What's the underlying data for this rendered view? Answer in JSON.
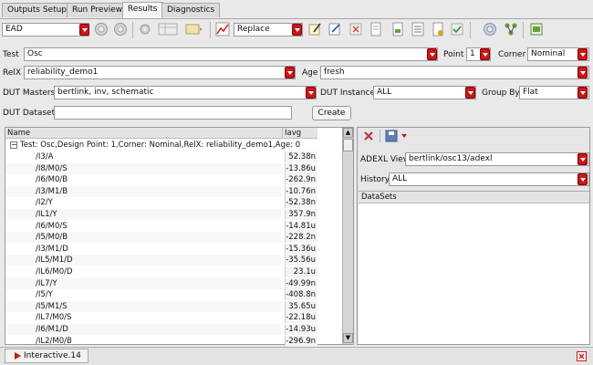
{
  "tabs": [
    {
      "label": "Outputs Setup",
      "active": false
    },
    {
      "label": "Run Preview",
      "active": false
    },
    {
      "label": "Results",
      "active": true
    },
    {
      "label": "Diagnostics",
      "active": false
    }
  ],
  "toolbar": {
    "view_combo": "EAD",
    "mode_combo": "Replace"
  },
  "filters": {
    "test_label": "Test",
    "test_value": "Osc",
    "point_label": "Point",
    "point_value": "1",
    "corner_label": "Corner",
    "corner_value": "Nominal",
    "relx_label": "RelX",
    "relx_value": "reliability_demo1",
    "age_label": "Age",
    "age_value": "fresh",
    "dut_masters_label": "DUT Masters",
    "dut_masters_value": "bertlink, inv, schematic",
    "dut_instance_label": "DUT Instance",
    "dut_instance_value": "ALL",
    "group_by_label": "Group By",
    "group_by_value": "Flat",
    "dut_dataset_label": "DUT Dataset",
    "dut_dataset_value": "",
    "create_label": "Create"
  },
  "table": {
    "col_name": "Name",
    "col_iavg": "Iavg",
    "group_row": "Test: Osc,Design Point: 1,Corner: Nominal,RelX: reliability_demo1,Age: 0",
    "rows": [
      {
        "name": "/I3/A",
        "iavg": "52.38n"
      },
      {
        "name": "/I8/M0/S",
        "iavg": "-13.86u"
      },
      {
        "name": "/I6/M0/B",
        "iavg": "-262.9n"
      },
      {
        "name": "/I3/M1/B",
        "iavg": "-10.76n"
      },
      {
        "name": "/I2/Y",
        "iavg": "-52.38n"
      },
      {
        "name": "/IL1/Y",
        "iavg": "357.9n"
      },
      {
        "name": "/I6/M0/S",
        "iavg": "-14.81u"
      },
      {
        "name": "/I5/M0/B",
        "iavg": "-228.2n"
      },
      {
        "name": "/I3/M1/D",
        "iavg": "-15.36u"
      },
      {
        "name": "/IL5/M1/D",
        "iavg": "-35.56u"
      },
      {
        "name": "/IL6/M0/D",
        "iavg": "23.1u"
      },
      {
        "name": "/IL7/Y",
        "iavg": "-49.99n"
      },
      {
        "name": "/I5/Y",
        "iavg": "-408.8n"
      },
      {
        "name": "/I5/M1/S",
        "iavg": "35.65u"
      },
      {
        "name": "/IL7/M0/S",
        "iavg": "-22.18u"
      },
      {
        "name": "/I6/M1/D",
        "iavg": "-14.93u"
      },
      {
        "name": "/IL2/M0/B",
        "iavg": "-296.9n"
      }
    ]
  },
  "right_panel": {
    "adexl_view_label": "ADEXL View",
    "adexl_view_value": "bertlink/osc13/adexl",
    "history_label": "History",
    "history_value": "ALL",
    "datasets_header": "DataSets"
  },
  "bottom": {
    "window_tab": "Interactive.14"
  },
  "colors": {
    "accent_red": "#c8181a",
    "panel_bg": "#e9e9e9"
  }
}
